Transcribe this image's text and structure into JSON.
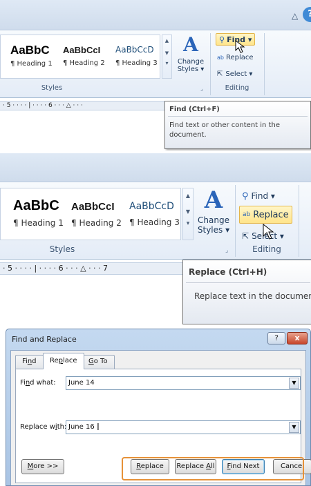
{
  "panel1": {
    "styles": [
      {
        "preview": "AaBbC",
        "label": "¶ Heading 1"
      },
      {
        "preview": "AaBbCcI",
        "label": "¶ Heading 2"
      },
      {
        "preview": "AaBbCcD",
        "label": "¶ Heading 3"
      }
    ],
    "change_styles": [
      "Change",
      "Styles ▾"
    ],
    "styles_group": "Styles",
    "find_label": "Find ▾",
    "replace_label": "Replace",
    "select_label": "Select ▾",
    "editing_group": "Editing",
    "ruler_text": "· 5 · · · · | · · · · 6 · · · △ · · ·",
    "tooltip_title": "Find (Ctrl+F)",
    "tooltip_body": "Find text or other content in the document.",
    "title_bar_icons": [
      "△",
      "?"
    ]
  },
  "panel2": {
    "styles": [
      {
        "preview": "AaBbC",
        "label": "¶ Heading 1"
      },
      {
        "preview": "AaBbCcI",
        "label": "¶ Heading 2"
      },
      {
        "preview": "AaBbCcD",
        "label": "¶ Heading 3"
      }
    ],
    "change_styles": [
      "Change",
      "Styles ▾"
    ],
    "styles_group": "Styles",
    "find_label": "Find ▾",
    "replace_label": "Replace",
    "select_label": "Select ▾",
    "editing_group": "Editing",
    "ruler_text": "· 5 · · · · | · · · · 6 · · · △ · · · 7",
    "tooltip_title": "Replace (Ctrl+H)",
    "tooltip_body": "Replace text in the documen"
  },
  "dialog": {
    "title": "Find and Replace",
    "help_btn": "?",
    "close_btn": "x",
    "tabs": [
      {
        "pre": "Fi",
        "acc": "n",
        "post": "d"
      },
      {
        "pre": "Re",
        "acc": "p",
        "post": "lace"
      },
      {
        "pre": "",
        "acc": "G",
        "post": "o To"
      }
    ],
    "find_label": {
      "pre": "Fi",
      "acc": "n",
      "post": "d what:"
    },
    "find_value": "June 14",
    "replace_label": {
      "pre": "Replace w",
      "acc": "i",
      "post": "th:"
    },
    "replace_value": "June 16",
    "more_btn": {
      "pre": "",
      "acc": "M",
      "post": "ore >>"
    },
    "replace_btn": {
      "pre": "",
      "acc": "R",
      "post": "eplace"
    },
    "replace_all_btn": {
      "pre": "Replace ",
      "acc": "A",
      "post": "ll"
    },
    "find_next_btn": {
      "pre": "",
      "acc": "F",
      "post": "ind Next"
    },
    "cancel_btn": "Cancel",
    "arrow": "▼"
  },
  "colors": {
    "ribbon_bg": "#e4ecf7",
    "highlight": "#ffe48a",
    "callout_border": "#e69138",
    "close_red": "#c7452b"
  }
}
